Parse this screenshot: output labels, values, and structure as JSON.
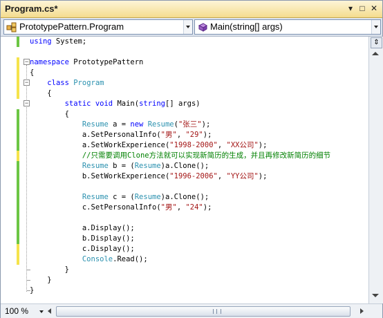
{
  "window": {
    "title": "Program.cs*"
  },
  "title_buttons": {
    "dropdown": "▾",
    "pin": "□",
    "close": "✕"
  },
  "navigation": {
    "type_combo": {
      "value": "PrototypePattern.Program",
      "icon": "class-icon"
    },
    "member_combo": {
      "value": "Main(string[] args)",
      "icon": "method-icon"
    }
  },
  "code": {
    "l1": {
      "a": "using",
      "b": " System;"
    },
    "l3": {
      "a": "namespace",
      "b": " PrototypePattern"
    },
    "l4": {
      "a": "{"
    },
    "l5": {
      "a": "    ",
      "b": "class",
      "c": " ",
      "d": "Program"
    },
    "l6": {
      "a": "    {"
    },
    "l7": {
      "a": "        ",
      "b": "static",
      "c": " ",
      "d": "void",
      "e": " Main(",
      "f": "string",
      "g": "[] args)"
    },
    "l8": {
      "a": "        {"
    },
    "l9": {
      "a": "            ",
      "b": "Resume",
      "c": " a = ",
      "d": "new",
      "e": " ",
      "f": "Resume",
      "g": "(",
      "h": "\"张三\"",
      "i": ");"
    },
    "l10": {
      "a": "            a.SetPersonalInfo(",
      "b": "\"男\"",
      "c": ", ",
      "d": "\"29\"",
      "e": ");"
    },
    "l11": {
      "a": "            a.SetWorkExperience(",
      "b": "\"1998-2000\"",
      "c": ", ",
      "d": "\"XX公司\"",
      "e": ");"
    },
    "l12": {
      "a": "            ",
      "b": "//只需要调用Clone方法就可以实现新简历的生成，并且再修改新简历的细节"
    },
    "l13": {
      "a": "            ",
      "b": "Resume",
      "c": " b = (",
      "d": "Resume",
      "e": ")a.Clone();"
    },
    "l14": {
      "a": "            b.SetWorkExperience(",
      "b": "\"1996-2006\"",
      "c": ", ",
      "d": "\"YY公司\"",
      "e": ");"
    },
    "l16": {
      "a": "            ",
      "b": "Resume",
      "c": " c = (",
      "d": "Resume",
      "e": ")a.Clone();"
    },
    "l17": {
      "a": "            c.SetPersonalInfo(",
      "b": "\"男\"",
      "c": ", ",
      "d": "\"24\"",
      "e": ");"
    },
    "l19": {
      "a": "            a.Display();"
    },
    "l20": {
      "a": "            b.Display();"
    },
    "l21": {
      "a": "            c.Display();"
    },
    "l22": {
      "a": "            ",
      "b": "Console",
      "c": ".Read();"
    },
    "l23": {
      "a": "        }"
    },
    "l24": {
      "a": "    }"
    },
    "l25": {
      "a": "}"
    }
  },
  "outlining": {
    "collapse": "−"
  },
  "status": {
    "zoom": "100 %",
    "scroll_grip": "|||"
  },
  "colors": {
    "keyword": "#0000ff",
    "type": "#2b91af",
    "string": "#a31515",
    "comment": "#008000",
    "changed_saved": "#6cc644",
    "changed_unsaved": "#f5e34c"
  }
}
